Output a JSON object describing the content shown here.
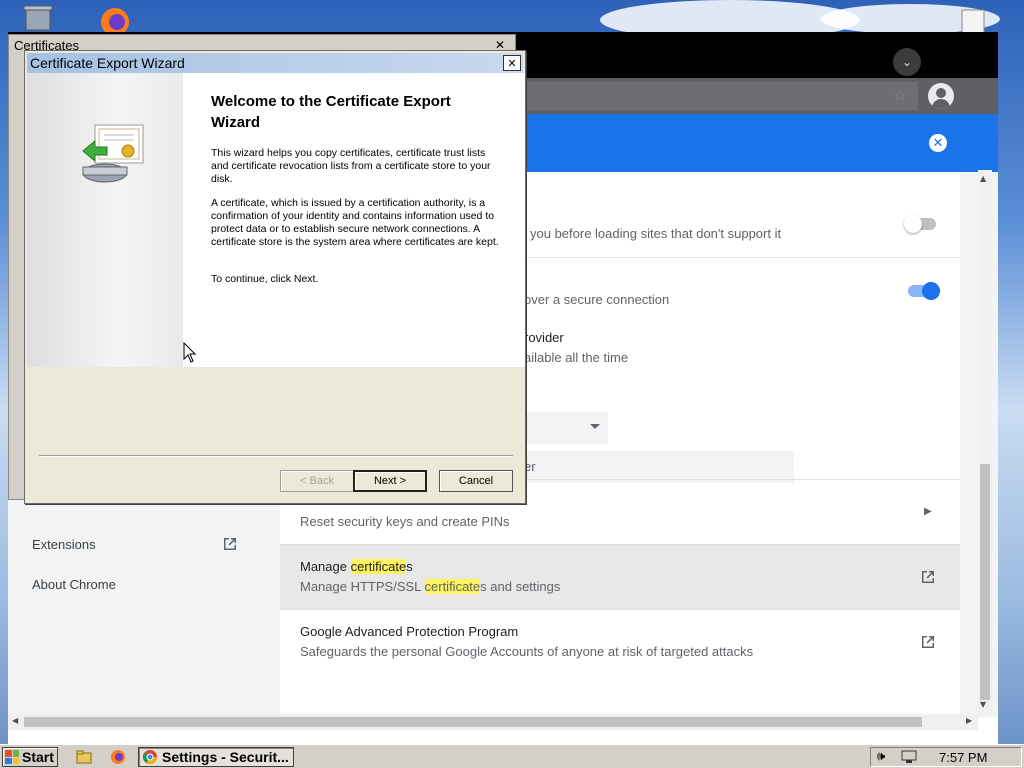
{
  "wizard": {
    "title": "Certificate Export Wizard",
    "heading": "Welcome to the Certificate Export Wizard",
    "para1": "This wizard helps you copy certificates, certificate trust lists and certificate revocation lists from a certificate store to your disk.",
    "para2": "A certificate, which is issued by a certification authority, is a confirmation of your identity and contains information used to protect data or to establish secure network connections. A certificate store is the system area where certificates are kept.",
    "para3": "To continue, click Next.",
    "back_label": "< Back",
    "next_label": "Next >",
    "cancel_label": "Cancel",
    "close_glyph": "✕"
  },
  "certificates_window": {
    "title": "Certificates",
    "close_glyph": "✕"
  },
  "chrome": {
    "tab_search_glyph": "⌄",
    "star_glyph": "☆",
    "banner_close_glyph": "✕"
  },
  "sidebar": {
    "items": [
      {
        "label": "Extensions",
        "icon": "open-in-new-icon"
      },
      {
        "label": "About Chrome"
      }
    ]
  },
  "security": {
    "rows_partial": [
      {
        "sub": "you before loading sites that don't support it",
        "toggle": "off"
      },
      {
        "sub": "over a secure connection",
        "toggle": "on"
      },
      {
        "title": "rovider",
        "sub": "ailable all the time"
      },
      {
        "input_text": "er"
      }
    ],
    "rows": [
      {
        "sub": "Reset security keys and create PINs",
        "icon": "chevron-right-icon"
      },
      {
        "title_before": "Manage ",
        "title_hl": "certificate",
        "title_after": "s",
        "sub_before": "Manage HTTPS/SSL ",
        "sub_hl": "certificate",
        "sub_after": "s and settings",
        "icon": "open-in-new-icon"
      },
      {
        "title": "Google Advanced Protection Program",
        "sub": "Safeguards the personal Google Accounts of anyone at risk of targeted attacks",
        "icon": "open-in-new-icon"
      }
    ]
  },
  "taskbar": {
    "start_label": "Start",
    "task_label": "Settings - Securit...",
    "clock": "7:57 PM"
  },
  "colors": {
    "chrome_blue": "#1a73e8",
    "highlight": "#fff45e",
    "toggle_on": "#1a73e8"
  }
}
